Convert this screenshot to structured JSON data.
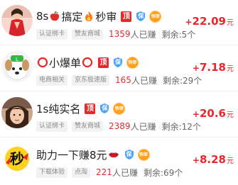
{
  "tasks": [
    {
      "title_parts": [
        "8s",
        "搞定",
        "秒审"
      ],
      "tags": [
        "认证绑卡",
        "赞友商城"
      ],
      "earned_count": "1359",
      "earned_suffix": "人已赚",
      "remaining": "剩余:5个",
      "price_sign": "+",
      "price_amount": "22.09",
      "price_unit": "元",
      "badges": {
        "ding": "顶",
        "bao": "保",
        "kuai": "快审"
      },
      "avatar": "woman-red-dress-avatar"
    },
    {
      "title_parts": [
        "小爆单"
      ],
      "tags": [
        "电商相关",
        "京东极速版"
      ],
      "earned_count": "165",
      "earned_suffix": "人已赚",
      "remaining": "剩余:29个",
      "price_sign": "+",
      "price_amount": "7.18",
      "price_unit": "元",
      "badges": {
        "ding": "顶",
        "bao": "保",
        "kuai": "快审"
      },
      "avatar": "dog-cartoon-avatar"
    },
    {
      "title_parts": [
        "1s纯实名"
      ],
      "tags": [
        "认证绑卡",
        "赞友商城"
      ],
      "earned_count": "2389",
      "earned_suffix": "人已赚",
      "remaining": "剩余:12个",
      "price_sign": "+",
      "price_amount": "20.6",
      "price_unit": "元",
      "badges": {
        "ding": "顶",
        "bao": "保",
        "kuai": "快审"
      },
      "avatar": "girl-photo-avatar"
    },
    {
      "title_parts": [
        "助力一下赚8元"
      ],
      "tags": [
        "下载体验",
        "点淘"
      ],
      "earned_count": "221",
      "earned_suffix": "人已赚",
      "remaining": "剩余:69个",
      "price_sign": "+",
      "price_amount": "8.28",
      "price_unit": "元",
      "badges": {
        "bao": "保",
        "kuai": "快审"
      },
      "avatar": "miao-character-avatar",
      "avatar_text": "秒"
    }
  ],
  "colors": {
    "accent_red": "#e8282b",
    "shield_blue": "#4aa3f5",
    "fast_orange": "#ff9f1a",
    "tag_bg": "#f2f2f2",
    "tag_text": "#8a8a8a"
  }
}
